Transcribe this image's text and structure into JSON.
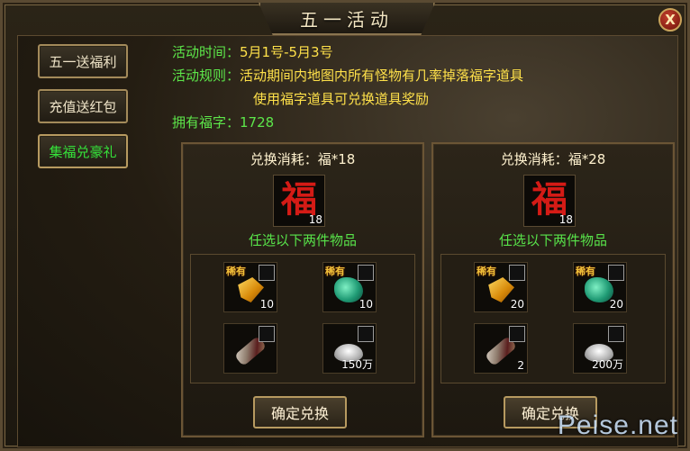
{
  "window": {
    "title": "五一活动",
    "close_label": "X"
  },
  "sidebar": {
    "items": [
      {
        "label": "五一送福利"
      },
      {
        "label": "充值送红包"
      },
      {
        "label": "集福兑豪礼"
      }
    ]
  },
  "info": {
    "time_label": "活动时间：",
    "time_value": "5月1号-5月3号",
    "rule_label": "活动规则：",
    "rule_line1": "活动期间内地图内所有怪物有几率掉落福字道具",
    "rule_line2": "使用福字道具可兑换道具奖励",
    "own_label": "拥有福字：",
    "own_value": "1728"
  },
  "panels": [
    {
      "cost": "兑换消耗：福*18",
      "fu_char": "福",
      "fu_count": "18",
      "choose_text": "任选以下两件物品",
      "items": [
        {
          "icon": "gold-ore-icon",
          "rare": "稀有",
          "count": "10"
        },
        {
          "icon": "jade-stone-icon",
          "rare": "稀有",
          "count": "10"
        },
        {
          "icon": "scroll-icon",
          "rare": "",
          "count": ""
        },
        {
          "icon": "silver-ingot-icon",
          "rare": "",
          "count": "150万"
        }
      ],
      "confirm_label": "确定兑换"
    },
    {
      "cost": "兑换消耗：福*28",
      "fu_char": "福",
      "fu_count": "18",
      "choose_text": "任选以下两件物品",
      "items": [
        {
          "icon": "gold-ore-icon",
          "rare": "稀有",
          "count": "20"
        },
        {
          "icon": "jade-stone-icon",
          "rare": "稀有",
          "count": "20"
        },
        {
          "icon": "scroll-icon",
          "rare": "",
          "count": "2"
        },
        {
          "icon": "silver-ingot-icon",
          "rare": "",
          "count": "200万"
        }
      ],
      "confirm_label": "确定兑换"
    }
  ],
  "watermark": "Peise.net"
}
